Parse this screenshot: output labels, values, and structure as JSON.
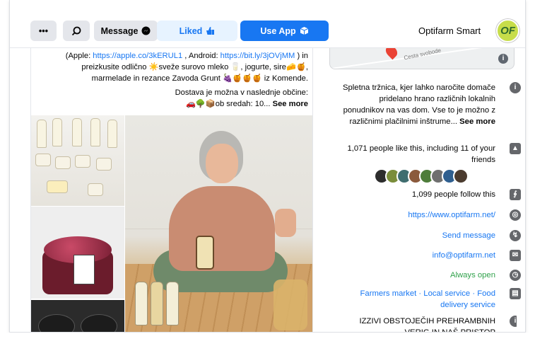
{
  "header": {
    "page_name": "Optifarm Smart",
    "logo_text": "OF",
    "buttons": {
      "more": "•••",
      "message": "Message",
      "liked": "Liked",
      "use_app": "Use App"
    }
  },
  "post": {
    "line1_prefix": "(Apple: ",
    "link_apple": "https://apple.co/3kERUL1",
    "line1_mid": " , Android: ",
    "link_android": "https://bit.ly/3jOVjMM",
    "line1_suffix": " ) in",
    "line2": "preizkusite odlično ☀️sveže surovo mleko 🥛, jogurte, sire🧀🍯,",
    "line3": "marmelade in rezance Zavoda Grunt 🍇🍯🍯🍯 iz Komende.",
    "line4": "Dostava je možna v naslednje občine:",
    "line5_prefix": "🚗🌳📦ob sredah: 10... ",
    "see_more": "See more"
  },
  "sidebar": {
    "map_street": "Cesta svobode",
    "description": "Spletna tržnica, kjer lahko naročite domače pridelano hrano različnih lokalnih ponudnikov na vas dom. Vse to je možno z različnimi plačilnimi inštrume... ",
    "description_see_more": "See more",
    "likes": "1,071 people like this, including 11 of your friends",
    "follows": "1,099 people follow this",
    "website": "https://www.optifarm.net/",
    "send_message": "Send message",
    "email": "info@optifarm.net",
    "hours": "Always open",
    "categories": "Farmers market · Local service · Food delivery service",
    "notice": "IZZIVI OBSTOJEČIH PREHRAMBNIH VERIG IN NAŠ PRISTOP"
  },
  "colors": {
    "primary": "#1877f2",
    "liked_bg": "#e7f3ff",
    "gray_button": "#e4e6eb",
    "open_green": "#31a24c"
  }
}
